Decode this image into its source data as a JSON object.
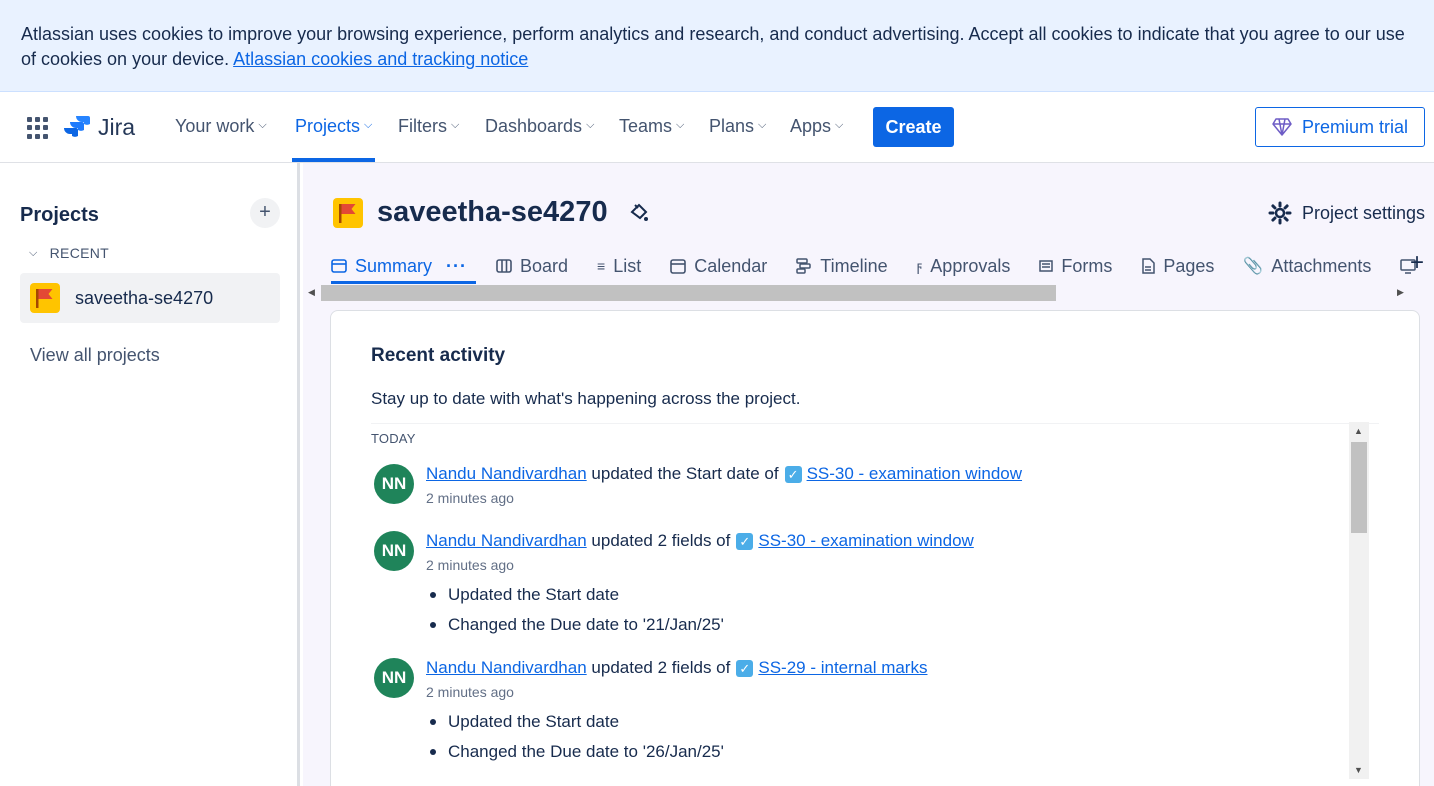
{
  "cookie_banner": {
    "text": "Atlassian uses cookies to improve your browsing experience, perform analytics and research, and conduct advertising. Accept all cookies to indicate that you agree to our use of cookies on your device. ",
    "link": "Atlassian cookies and tracking notice"
  },
  "topnav": {
    "logo": "Jira",
    "items": [
      {
        "label": "Your work"
      },
      {
        "label": "Projects"
      },
      {
        "label": "Filters"
      },
      {
        "label": "Dashboards"
      },
      {
        "label": "Teams"
      },
      {
        "label": "Plans"
      },
      {
        "label": "Apps"
      }
    ],
    "active_item": "Projects",
    "create_label": "Create",
    "premium_label": "Premium trial"
  },
  "sidebar": {
    "title": "Projects",
    "add_icon": "plus-icon",
    "recent_label": "RECENT",
    "recent_project": "saveetha-se4270",
    "view_all": "View all projects"
  },
  "project": {
    "name": "saveetha-se4270",
    "settings_label": "Project settings",
    "tabs": [
      {
        "label": "Summary",
        "icon": "summary-icon"
      },
      {
        "label": "Board",
        "icon": "board-icon"
      },
      {
        "label": "List",
        "icon": "list-icon"
      },
      {
        "label": "Calendar",
        "icon": "calendar-icon"
      },
      {
        "label": "Timeline",
        "icon": "timeline-icon"
      },
      {
        "label": "Approvals",
        "icon": "approvals-icon"
      },
      {
        "label": "Forms",
        "icon": "forms-icon"
      },
      {
        "label": "Pages",
        "icon": "pages-icon"
      },
      {
        "label": "Attachments",
        "icon": "attachment-icon"
      }
    ],
    "active_tab": "Summary"
  },
  "activity": {
    "title": "Recent activity",
    "subtitle": "Stay up to date with what's happening across the project.",
    "group_label": "TODAY",
    "entries": [
      {
        "initials": "NN",
        "user": "Nandu Nandivardhan",
        "action": "updated the Start date of",
        "issue": "SS-30 - examination window",
        "time": "2 minutes ago",
        "details": []
      },
      {
        "initials": "NN",
        "user": "Nandu Nandivardhan",
        "action": "updated 2 fields of",
        "issue": "SS-30 - examination window",
        "time": "2 minutes ago",
        "details": [
          "Updated the Start date",
          "Changed the Due date to '21/Jan/25'"
        ]
      },
      {
        "initials": "NN",
        "user": "Nandu Nandivardhan",
        "action": "updated 2 fields of",
        "issue": "SS-29 - internal marks",
        "time": "2 minutes ago",
        "details": [
          "Updated the Start date",
          "Changed the Due date to '26/Jan/25'"
        ]
      }
    ]
  },
  "colors": {
    "brand_blue": "#0c66e4",
    "avatar_green": "#1f845a",
    "project_yellow": "#ffc400",
    "project_flag": "#e34935"
  }
}
